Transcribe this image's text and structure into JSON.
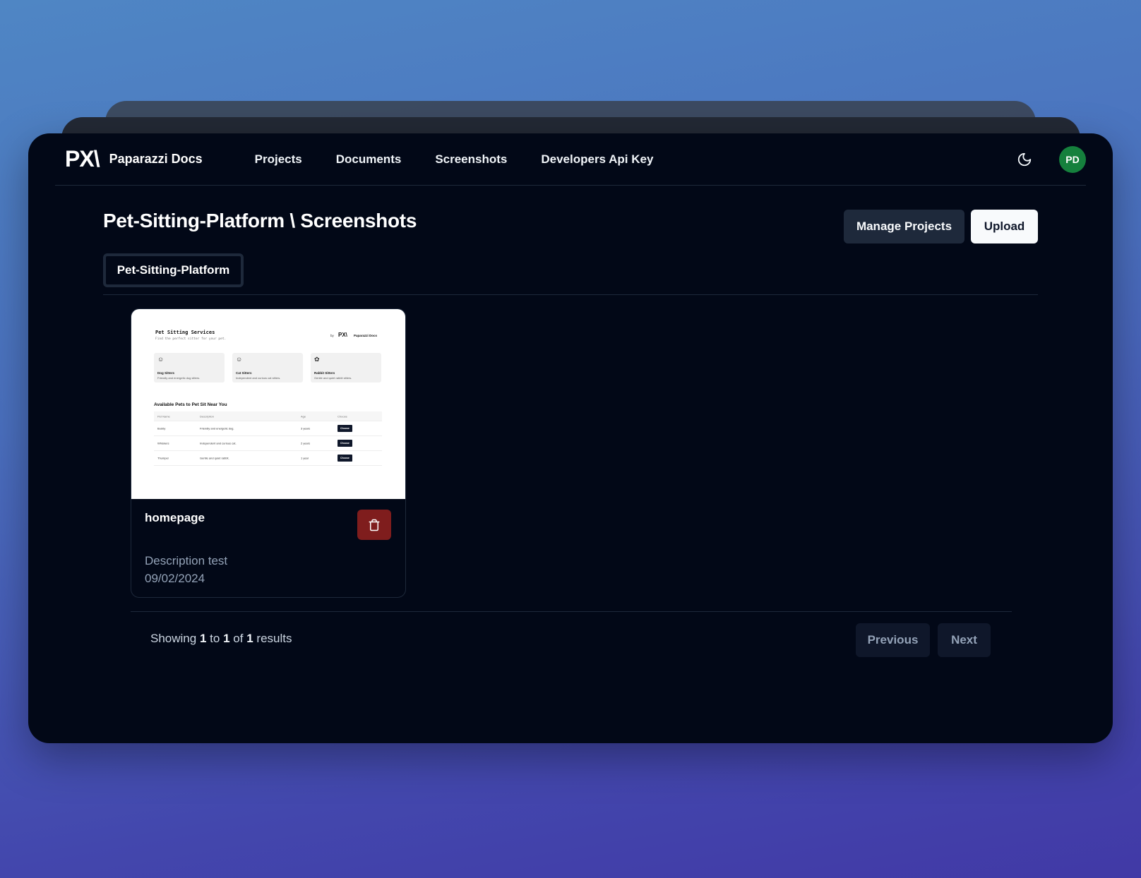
{
  "app": {
    "logo_mark": "PX\\",
    "logo_text": "Paparazzi Docs"
  },
  "nav": {
    "items": [
      {
        "label": "Projects"
      },
      {
        "label": "Documents"
      },
      {
        "label": "Screenshots"
      },
      {
        "label": "Developers Api Key"
      }
    ],
    "theme_icon": "moon-icon",
    "avatar_initials": "PD",
    "avatar_color": "#15803d"
  },
  "header": {
    "title": "Pet-Sitting-Platform \\ Screenshots",
    "manage_label": "Manage Projects",
    "upload_label": "Upload"
  },
  "project_tabs": [
    {
      "label": "Pet-Sitting-Platform",
      "selected": true
    }
  ],
  "screenshots": [
    {
      "name": "homepage",
      "description": "Description test",
      "date": "09/02/2024",
      "delete_icon": "trash-icon",
      "delete_color": "#7f1d1d",
      "preview": {
        "title": "Pet Sitting Services",
        "subtitle": "Find the perfect sitter for your pet.",
        "by": "by",
        "logo_mark": "PX\\",
        "logo_text": "Paparazzi Docs",
        "services": [
          {
            "icon": "dog-icon",
            "title": "Dog Sitters",
            "desc": "Friendly and energetic dog sitters."
          },
          {
            "icon": "cat-icon",
            "title": "Cat Sitters",
            "desc": "Independent and curious cat sitters."
          },
          {
            "icon": "rabbit-icon",
            "title": "Rabbit Sitters",
            "desc": "Gentle and quiet rabbit sitters."
          }
        ],
        "table_title": "Available Pets to Pet Sit Near You",
        "columns": [
          "Pet Name",
          "Description",
          "Age",
          "Choose"
        ],
        "rows": [
          {
            "name": "Buddy",
            "desc": "Friendly and energetic dog.",
            "age": "3 years",
            "action": "Choose"
          },
          {
            "name": "Whiskers",
            "desc": "Independent and curious cat.",
            "age": "2 years",
            "action": "Choose"
          },
          {
            "name": "Thumper",
            "desc": "Gentle and quiet rabbit.",
            "age": "1 year",
            "action": "Choose"
          }
        ]
      }
    }
  ],
  "pagination": {
    "prefix": "Showing",
    "from": "1",
    "to_word": "to",
    "to": "1",
    "of_word": "of",
    "total": "1",
    "suffix": "results",
    "previous_label": "Previous",
    "next_label": "Next"
  }
}
